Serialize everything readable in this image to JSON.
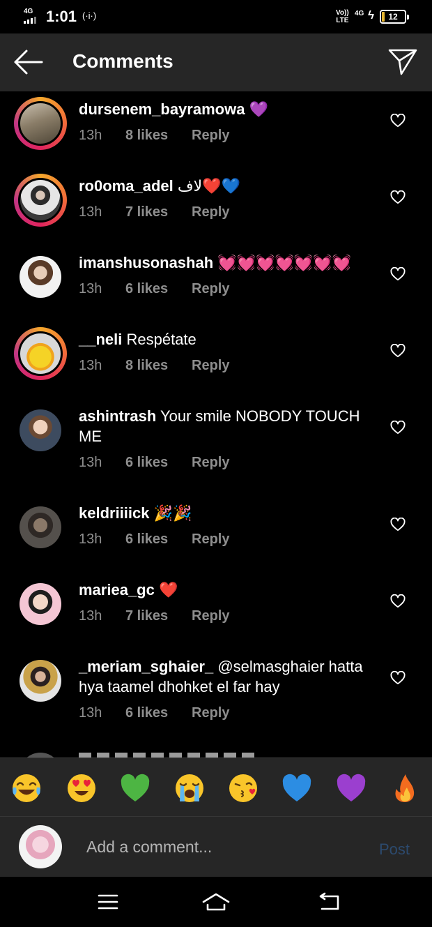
{
  "status_bar": {
    "network": "4G",
    "time": "1:01",
    "hotspot": "(·i·)",
    "volte_top": "Vo))",
    "volte_bottom": "LTE",
    "data": "4G",
    "battery": "12",
    "battery_level_percent": 12
  },
  "header": {
    "title": "Comments",
    "back_icon": "back-arrow-icon",
    "send_icon": "send-icon"
  },
  "comments": [
    {
      "username": "dursenem_bayramowa",
      "text": " 💜",
      "time": "13h",
      "likes": "8 likes",
      "reply": "Reply"
    },
    {
      "username": "ro0oma_adel",
      "text": " لاف❤️💙",
      "time": "13h",
      "likes": "7 likes",
      "reply": "Reply"
    },
    {
      "username": "imanshusonashah",
      "text": " 💓💓💓💓💓💓💓",
      "time": "13h",
      "likes": "6 likes",
      "reply": "Reply"
    },
    {
      "username": "__neli",
      "text": " Respétate",
      "time": "13h",
      "likes": "8 likes",
      "reply": "Reply"
    },
    {
      "username": "ashintrash",
      "text": " Your smile NOBODY TOUCH ME",
      "time": "13h",
      "likes": "6 likes",
      "reply": "Reply"
    },
    {
      "username": "keldriiiick",
      "text": " 🎉🎉",
      "time": "13h",
      "likes": "6 likes",
      "reply": "Reply"
    },
    {
      "username": "mariea_gc",
      "text": " ❤️",
      "time": "13h",
      "likes": "7 likes",
      "reply": "Reply"
    },
    {
      "username": "_meriam_sghaier_",
      "text": " @selmasghaier hatta hya taamel dhohket el far hay",
      "time": "13h",
      "likes": "6 likes",
      "reply": "Reply"
    }
  ],
  "emoji_bar": [
    "😂",
    "😍",
    "💚",
    "😭",
    "😘",
    "💙",
    "💜",
    "🔥"
  ],
  "comment_box": {
    "placeholder": "Add a comment...",
    "post": "Post"
  },
  "nav_bar": [
    "menu-icon",
    "home-icon",
    "back-icon"
  ],
  "colors": {
    "background": "#000000",
    "bar": "#262626",
    "muted": "#8e8e8e",
    "post_disabled": "#2c4a6e"
  }
}
